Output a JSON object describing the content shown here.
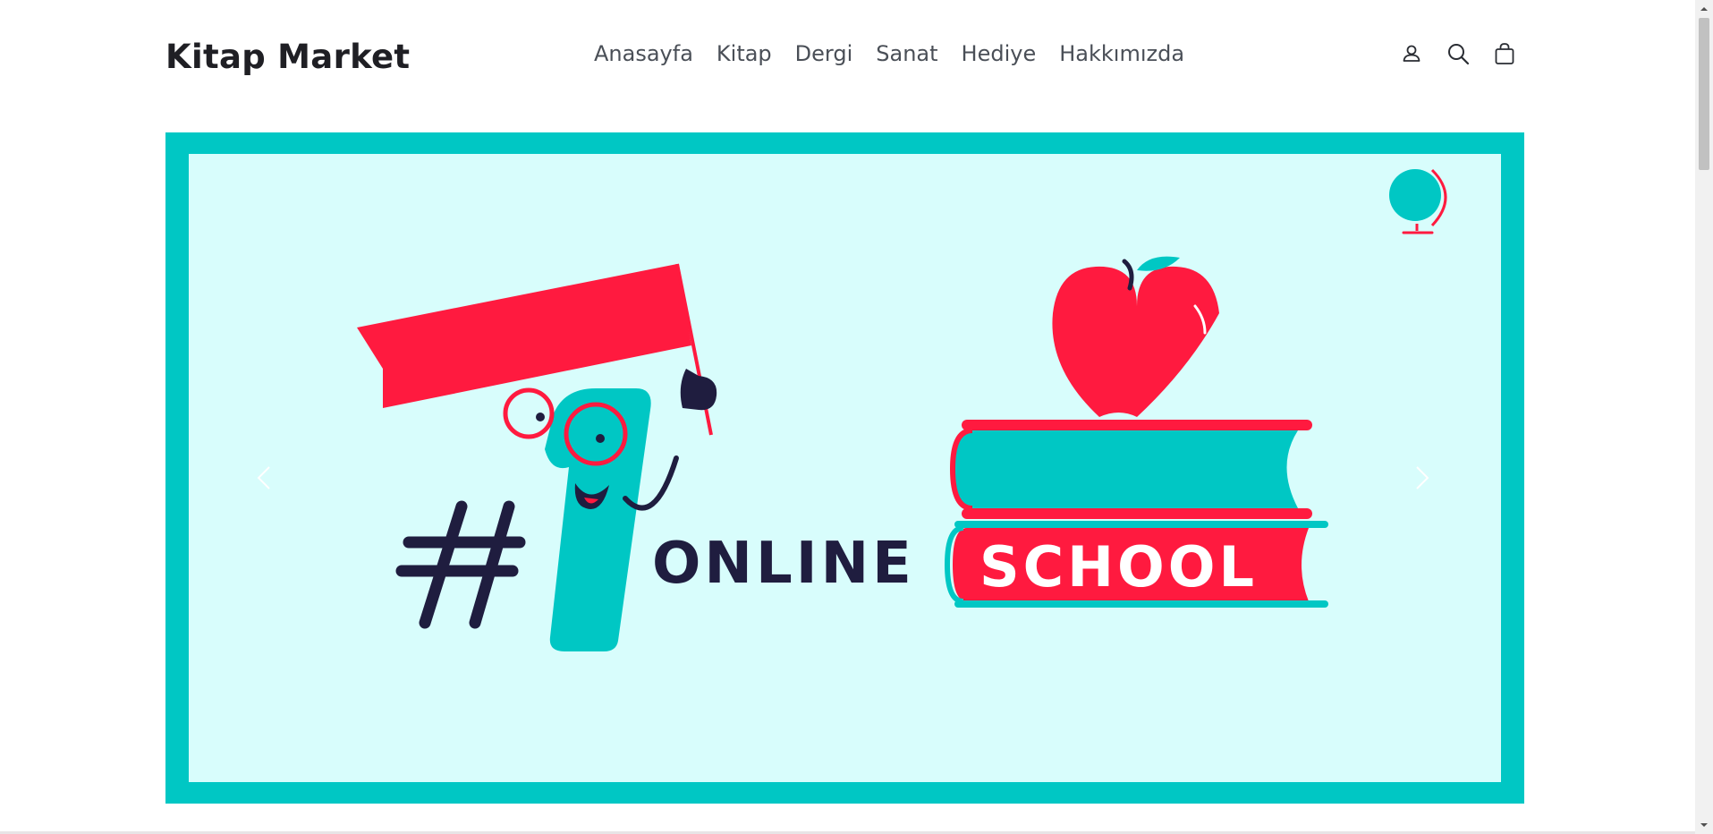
{
  "header": {
    "logo": "Kitap Market",
    "nav": [
      "Anasayfa",
      "Kitap",
      "Dergi",
      "Sanat",
      "Hediye",
      "Hakkımızda"
    ],
    "icons": [
      "account-icon",
      "search-icon",
      "cart-bag-icon"
    ]
  },
  "banner": {
    "headline_prefix": "#1",
    "headline_word1": "ONLINE",
    "headline_word2": "SCHOOL",
    "colors": {
      "frame": "#00c7c4",
      "background": "#d8fdfc",
      "red": "#ff1a3f",
      "navy": "#1f1d3f",
      "teal": "#00c7c4"
    },
    "controls": [
      "chevron-left-icon",
      "chevron-right-icon"
    ]
  }
}
